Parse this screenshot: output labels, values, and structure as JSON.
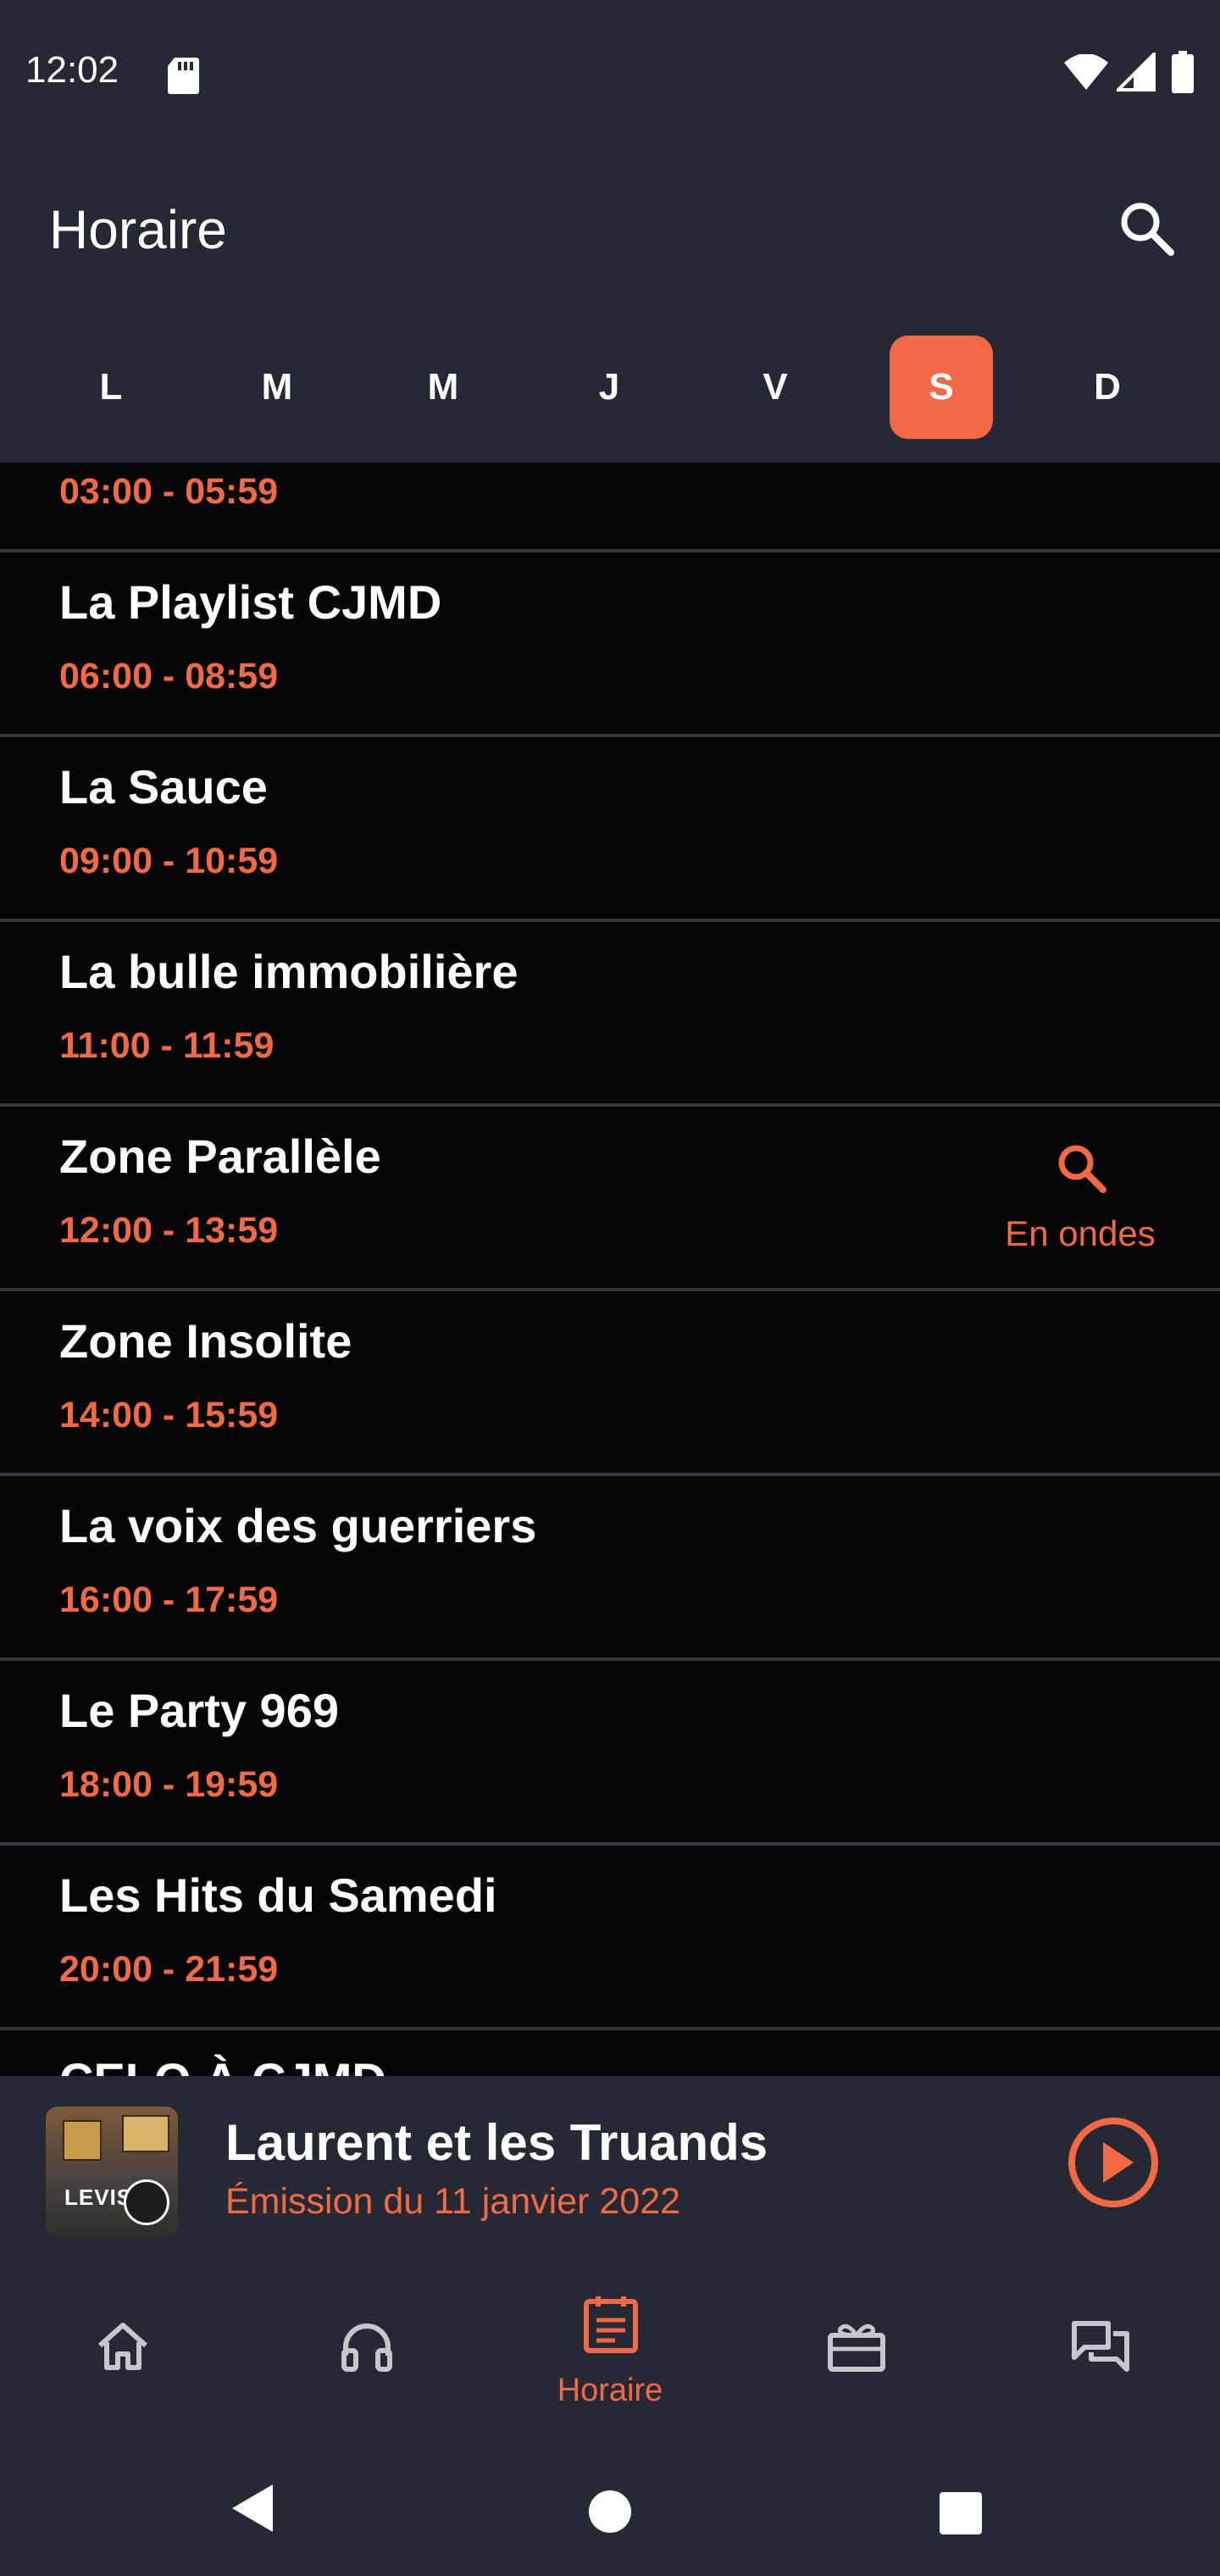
{
  "status_bar": {
    "time": "12:02",
    "icons": [
      "sd-card-icon",
      "wifi-icon",
      "cell-signal-icon",
      "battery-icon"
    ]
  },
  "header": {
    "title": "Horaire",
    "search_icon": "search-icon"
  },
  "days": [
    {
      "label": "L",
      "selected": false
    },
    {
      "label": "M",
      "selected": false
    },
    {
      "label": "M",
      "selected": false
    },
    {
      "label": "J",
      "selected": false
    },
    {
      "label": "V",
      "selected": false
    },
    {
      "label": "S",
      "selected": true
    },
    {
      "label": "D",
      "selected": false
    }
  ],
  "schedule": [
    {
      "name": "",
      "time": "03:00 - 05:59"
    },
    {
      "name": "La Playlist CJMD",
      "time": "06:00 - 08:59"
    },
    {
      "name": "La Sauce",
      "time": "09:00 - 10:59"
    },
    {
      "name": "La bulle immobilière",
      "time": "11:00 - 11:59"
    },
    {
      "name": "Zone Parallèle",
      "time": "12:00 - 13:59",
      "on_air": true
    },
    {
      "name": "Zone Insolite",
      "time": "14:00 - 15:59"
    },
    {
      "name": "La voix des guerriers",
      "time": "16:00 - 17:59"
    },
    {
      "name": "Le Party 969",
      "time": "18:00 - 19:59"
    },
    {
      "name": "Les Hits du Samedi",
      "time": "20:00 - 21:59"
    },
    {
      "name": "CELO À CJMD",
      "time": ""
    }
  ],
  "on_air": {
    "label": "En ondes",
    "icon": "search-icon"
  },
  "player": {
    "title": "Laurent et les Truands",
    "subtitle": "Émission du 11 janvier 2022",
    "cover_text": "LEVIS",
    "play_icon": "play-circle-icon"
  },
  "bottom_nav": {
    "items": [
      {
        "icon": "home-icon",
        "label": "",
        "active": false
      },
      {
        "icon": "headphones-icon",
        "label": "",
        "active": false
      },
      {
        "icon": "calendar-icon",
        "label": "Horaire",
        "active": true
      },
      {
        "icon": "ticket-icon",
        "label": "",
        "active": false
      },
      {
        "icon": "chat-icon",
        "label": "",
        "active": false
      }
    ]
  },
  "colors": {
    "accent": "#f26a45",
    "bar_background": "#262933",
    "list_background": "#050407",
    "divider": "#34363c"
  }
}
